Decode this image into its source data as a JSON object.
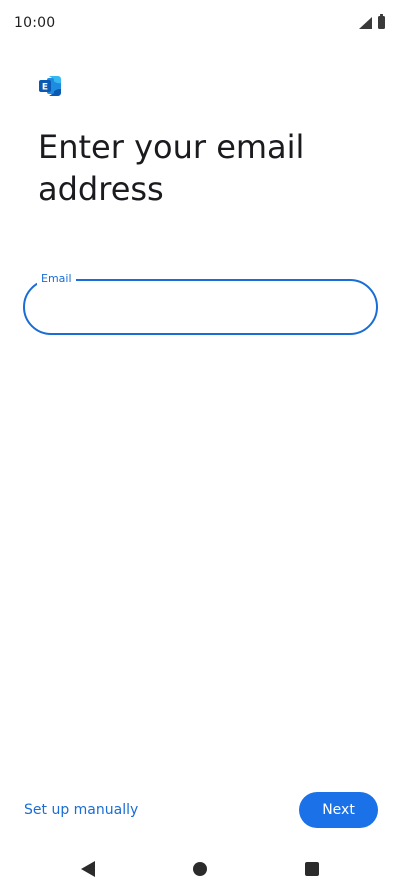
{
  "status_bar": {
    "time": "10:00",
    "icons": [
      "signal-icon",
      "battery-icon"
    ]
  },
  "app": {
    "logo_icon": "exchange-logo-icon",
    "logo_letter": "E",
    "brand_colors": {
      "dark_blue": "#0a5ab3",
      "mid_blue": "#1c8be0",
      "light_blue": "#35b8f0"
    }
  },
  "page": {
    "title": "Enter your email address"
  },
  "email_field": {
    "label": "Email",
    "value": "",
    "placeholder": ""
  },
  "actions": {
    "setup_manually_label": "Set up manually",
    "next_label": "Next"
  },
  "nav_bar": {
    "icons": [
      "back-icon",
      "home-icon",
      "recents-icon"
    ]
  },
  "colors": {
    "accent": "#1a6dd4",
    "button_bg": "#1b72e8",
    "title_text": "#1b1b1f"
  }
}
